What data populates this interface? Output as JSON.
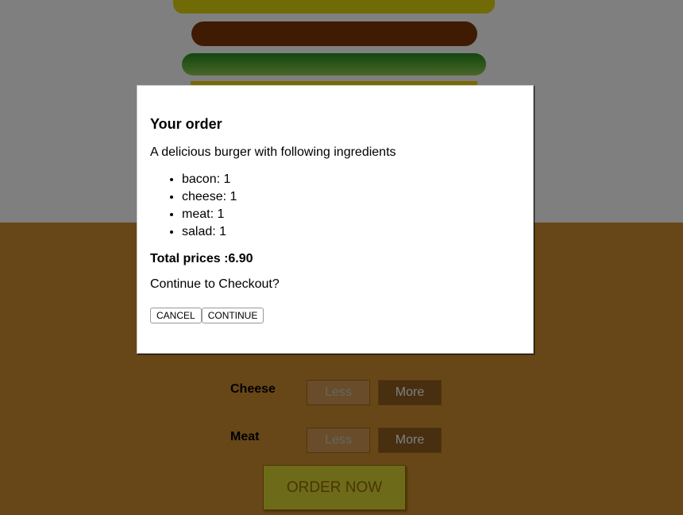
{
  "controls": [
    {
      "label": "Cheese",
      "less": "Less",
      "more": "More"
    },
    {
      "label": "Meat",
      "less": "Less",
      "more": "More"
    }
  ],
  "order_button": "ORDER NOW",
  "modal": {
    "title": "Your order",
    "description": "A delicious burger with following ingredients",
    "ingredients": [
      {
        "name": "bacon",
        "qty": 1,
        "text": "bacon: 1"
      },
      {
        "name": "cheese",
        "qty": 1,
        "text": "cheese: 1"
      },
      {
        "name": "meat",
        "qty": 1,
        "text": "meat: 1"
      },
      {
        "name": "salad",
        "qty": 1,
        "text": "salad: 1"
      }
    ],
    "total_label": "Total prices :",
    "total_value": "6.90",
    "total_text": "Total prices :6.90",
    "question": "Continue to Checkout?",
    "cancel_label": "CANCEL",
    "continue_label": "CONTINUE"
  },
  "colors": {
    "bread": "#e0d60e",
    "bacon": "#7f3608",
    "salad": "#228c1d",
    "controls_bg": "#cf8f2e",
    "order_button": "#dad735"
  }
}
